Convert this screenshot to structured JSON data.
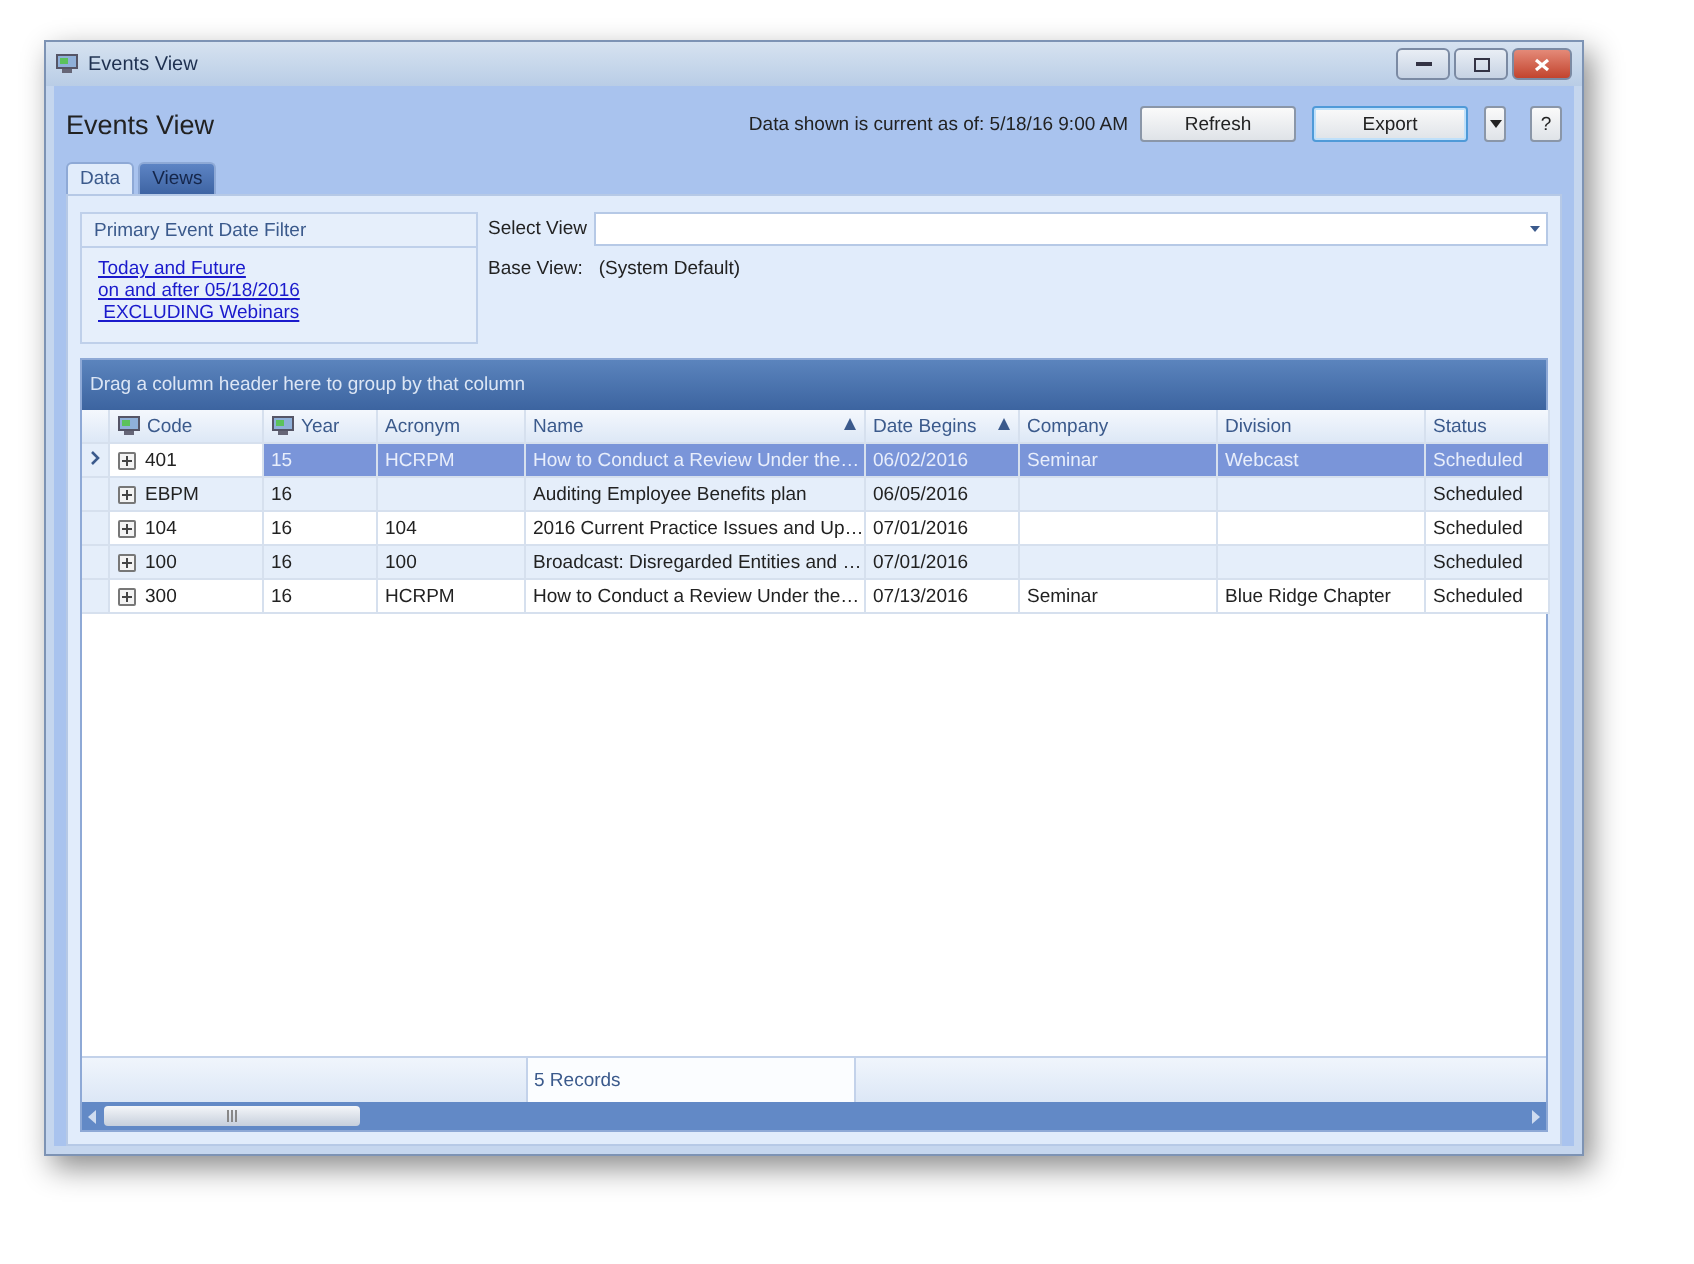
{
  "window": {
    "title": "Events View"
  },
  "header": {
    "title": "Events View",
    "data_note": "Data shown is current as of: 5/18/16 9:00 AM",
    "buttons": [
      {
        "label": "Refresh",
        "focused": false
      },
      {
        "label": "Export",
        "focused": true
      }
    ],
    "help": "?"
  },
  "tabs": [
    {
      "label": "Data",
      "selected": true
    },
    {
      "label": "Views",
      "selected": false
    }
  ],
  "filter_panel": {
    "title": "Primary Event Date Filter",
    "links": [
      "Today and Future",
      "on and after 05/18/2016",
      " EXCLUDING Webinars"
    ]
  },
  "view_select": {
    "label": "Select View",
    "base_label": "Base View:",
    "base_value": "(System Default)"
  },
  "grid": {
    "group_hint": "Drag a column header here to group by that column",
    "columns": [
      {
        "label": "Code",
        "filter_icon": true,
        "sorted": false
      },
      {
        "label": "Year",
        "filter_icon": true,
        "sorted": false
      },
      {
        "label": "Acronym",
        "filter_icon": false,
        "sorted": false
      },
      {
        "label": "Name",
        "filter_icon": false,
        "sorted": true
      },
      {
        "label": "Date Begins",
        "filter_icon": false,
        "sorted": true
      },
      {
        "label": "Company",
        "filter_icon": false,
        "sorted": false
      },
      {
        "label": "Division",
        "filter_icon": false,
        "sorted": false
      },
      {
        "label": "Status",
        "filter_icon": false,
        "sorted": false
      }
    ],
    "rows": [
      {
        "selected": true,
        "cells": [
          "401",
          "15",
          "HCRPM",
          "How to Conduct a Review Under the…",
          "06/02/2016",
          "Seminar",
          "Webcast",
          "Scheduled"
        ]
      },
      {
        "selected": false,
        "cells": [
          "EBPM",
          "16",
          "",
          "Auditing Employee Benefits plan",
          "06/05/2016",
          "",
          "",
          "Scheduled"
        ]
      },
      {
        "selected": false,
        "cells": [
          "104",
          "16",
          "104",
          "2016 Current Practice Issues and Up…",
          "07/01/2016",
          "",
          "",
          "Scheduled"
        ]
      },
      {
        "selected": false,
        "cells": [
          "100",
          "16",
          "100",
          "Broadcast: Disregarded Entities and …",
          "07/01/2016",
          "",
          "",
          "Scheduled"
        ]
      },
      {
        "selected": false,
        "cells": [
          "300",
          "16",
          "HCRPM",
          "How to Conduct a Review Under the…",
          "07/13/2016",
          "Seminar",
          "Blue Ridge Chapter",
          "Scheduled"
        ]
      }
    ],
    "footer": "5 Records"
  }
}
